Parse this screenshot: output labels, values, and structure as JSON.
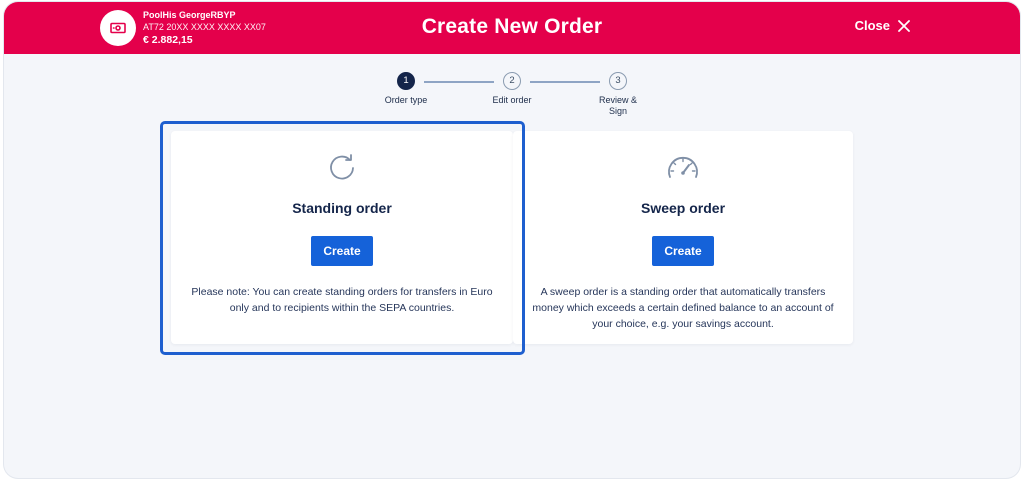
{
  "header": {
    "account_name": "PoolHis GeorgeRBYP",
    "account_iban": "AT72 20XX XXXX XXXX XX07",
    "account_balance": "€ 2.882,15",
    "title": "Create New Order",
    "close_label": "Close",
    "background_color": "#e4004b"
  },
  "stepper": {
    "steps": [
      {
        "number": "1",
        "label": "Order type",
        "state": "active"
      },
      {
        "number": "2",
        "label": "Edit order",
        "state": "upcoming"
      },
      {
        "number": "3",
        "label": "Review & Sign",
        "state": "upcoming"
      }
    ]
  },
  "options": [
    {
      "icon": "refresh-icon",
      "title": "Standing order",
      "button_label": "Create",
      "note": "Please note: You can create standing orders for transfers in Euro only and to recipients within the SEPA countries.",
      "selected": true
    },
    {
      "icon": "gauge-icon",
      "title": "Sweep order",
      "button_label": "Create",
      "note": "A sweep order is a standing order that automatically transfers money which exceeds a certain defined balance to an account of your choice, e.g. your savings account.",
      "selected": false
    }
  ],
  "colors": {
    "accent": "#1562d9",
    "selection_border": "#1e5fcf",
    "text_dark": "#14254a"
  }
}
